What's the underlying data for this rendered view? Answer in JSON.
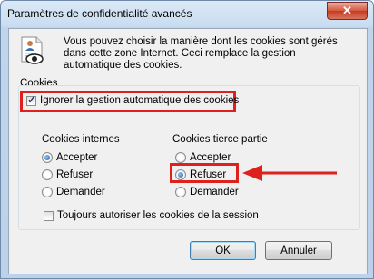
{
  "dialog": {
    "title": "Paramètres de confidentialité avancés",
    "close_symbol": "✕",
    "description": "Vous pouvez choisir la manière dont les cookies sont gérés dans cette zone Internet. Ceci remplace la gestion automatique des cookies."
  },
  "cookies": {
    "group_label": "Cookies",
    "override_label": "Ignorer la gestion automatique des cookies",
    "override_checked": true,
    "first_party": {
      "heading": "Cookies internes",
      "options": [
        "Accepter",
        "Refuser",
        "Demander"
      ],
      "selected": "Accepter"
    },
    "third_party": {
      "heading": "Cookies tierce partie",
      "options": [
        "Accepter",
        "Refuser",
        "Demander"
      ],
      "selected": "Refuser"
    },
    "session_label": "Toujours autoriser les cookies de la session",
    "session_checked": false
  },
  "buttons": {
    "ok": "OK",
    "cancel": "Annuler"
  },
  "icons": {
    "check": "✓",
    "privacy": "privacy-document-eye-icon",
    "arrow": "red-arrow-left-icon"
  },
  "colors": {
    "highlight": "#e0201c",
    "radio_selected": "#1b5fa8"
  }
}
